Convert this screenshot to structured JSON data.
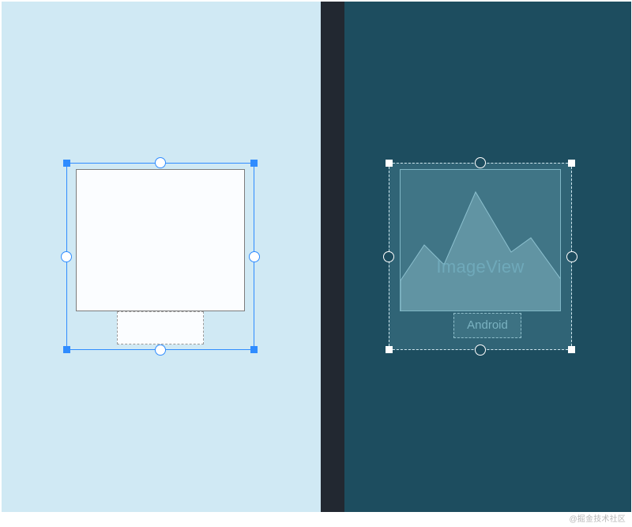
{
  "colors": {
    "left_panel_bg": "#d0e9f4",
    "right_panel_bg": "#1d4d5f",
    "mid_strip_bg": "#222831",
    "left_selection_stroke": "#2f8cff",
    "right_selection_stroke": "#ffffff"
  },
  "left": {
    "selection_kind": "layout_selection"
  },
  "right": {
    "imageview_label": "ImageView",
    "textview_label": "Android"
  },
  "watermark": "@掘金技术社区"
}
